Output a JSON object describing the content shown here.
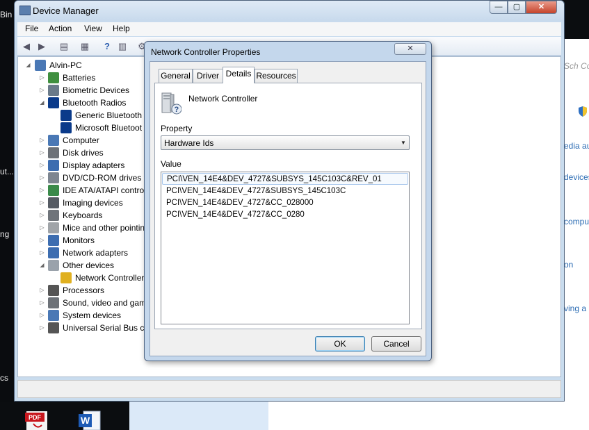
{
  "desktop": {
    "left_fragments": [
      "Bin",
      "ut...",
      "ng",
      "cs"
    ],
    "right_fragments": [
      "Sch Con",
      "edia au",
      "devices",
      "compu",
      "on",
      "ving a"
    ]
  },
  "device_manager": {
    "title": "Device Manager",
    "window_buttons": {
      "minimize": "—",
      "maximize": "▢",
      "close": "✕"
    },
    "menu": [
      "File",
      "Action",
      "View",
      "Help"
    ],
    "tree": {
      "root": "Alvin-PC",
      "items": [
        {
          "label": "Batteries",
          "icon": "battery-icon",
          "color": "#3f8f3f"
        },
        {
          "label": "Biometric Devices",
          "icon": "biometric-icon",
          "color": "#6a7a8a"
        },
        {
          "label": "Bluetooth Radios",
          "icon": "bluetooth-icon",
          "color": "#0a3a8a"
        },
        {
          "label": "Generic Bluetooth",
          "icon": "bluetooth-icon",
          "color": "#0a3a8a"
        },
        {
          "label": "Microsoft Bluetoot",
          "icon": "bluetooth-icon",
          "color": "#0a3a8a"
        },
        {
          "label": "Computer",
          "icon": "computer-icon",
          "color": "#4a78b5"
        },
        {
          "label": "Disk drives",
          "icon": "disk-drive-icon",
          "color": "#6c7178"
        },
        {
          "label": "Display adapters",
          "icon": "display-adapter-icon",
          "color": "#3d6db0"
        },
        {
          "label": "DVD/CD-ROM drives",
          "icon": "dvd-drive-icon",
          "color": "#7d8590"
        },
        {
          "label": "IDE ATA/ATAPI contro",
          "icon": "ide-controller-icon",
          "color": "#3a8a4a"
        },
        {
          "label": "Imaging devices",
          "icon": "camera-icon",
          "color": "#555b63"
        },
        {
          "label": "Keyboards",
          "icon": "keyboard-icon",
          "color": "#6f747a"
        },
        {
          "label": "Mice and other pointin",
          "icon": "mouse-icon",
          "color": "#a0a4a8"
        },
        {
          "label": "Monitors",
          "icon": "monitor-icon",
          "color": "#3d6db0"
        },
        {
          "label": "Network adapters",
          "icon": "network-adapter-icon",
          "color": "#3d6db0"
        },
        {
          "label": "Other devices",
          "icon": "unknown-device-icon",
          "color": "#9aa2ab"
        },
        {
          "label": "Network Controller",
          "icon": "warning-device-icon",
          "color": "#e0b020"
        },
        {
          "label": "Processors",
          "icon": "processor-icon",
          "color": "#555"
        },
        {
          "label": "Sound, video and gam",
          "icon": "speaker-icon",
          "color": "#6d7278"
        },
        {
          "label": "System devices",
          "icon": "system-device-icon",
          "color": "#4a78b5"
        },
        {
          "label": "Universal Serial Bus co",
          "icon": "usb-icon",
          "color": "#555"
        }
      ]
    }
  },
  "dialog": {
    "title": "Network Controller Properties",
    "close_label": "✕",
    "tabs": [
      "General",
      "Driver",
      "Details",
      "Resources"
    ],
    "active_tab": "Details",
    "device_name": "Network Controller",
    "property_label": "Property",
    "property_value": "Hardware Ids",
    "value_label": "Value",
    "values": [
      "PCI\\VEN_14E4&DEV_4727&SUBSYS_145C103C&REV_01",
      "PCI\\VEN_14E4&DEV_4727&SUBSYS_145C103C",
      "PCI\\VEN_14E4&DEV_4727&CC_028000",
      "PCI\\VEN_14E4&DEV_4727&CC_0280"
    ],
    "ok_label": "OK",
    "cancel_label": "Cancel"
  },
  "taskbar": {
    "pdf_label": "PDF"
  }
}
